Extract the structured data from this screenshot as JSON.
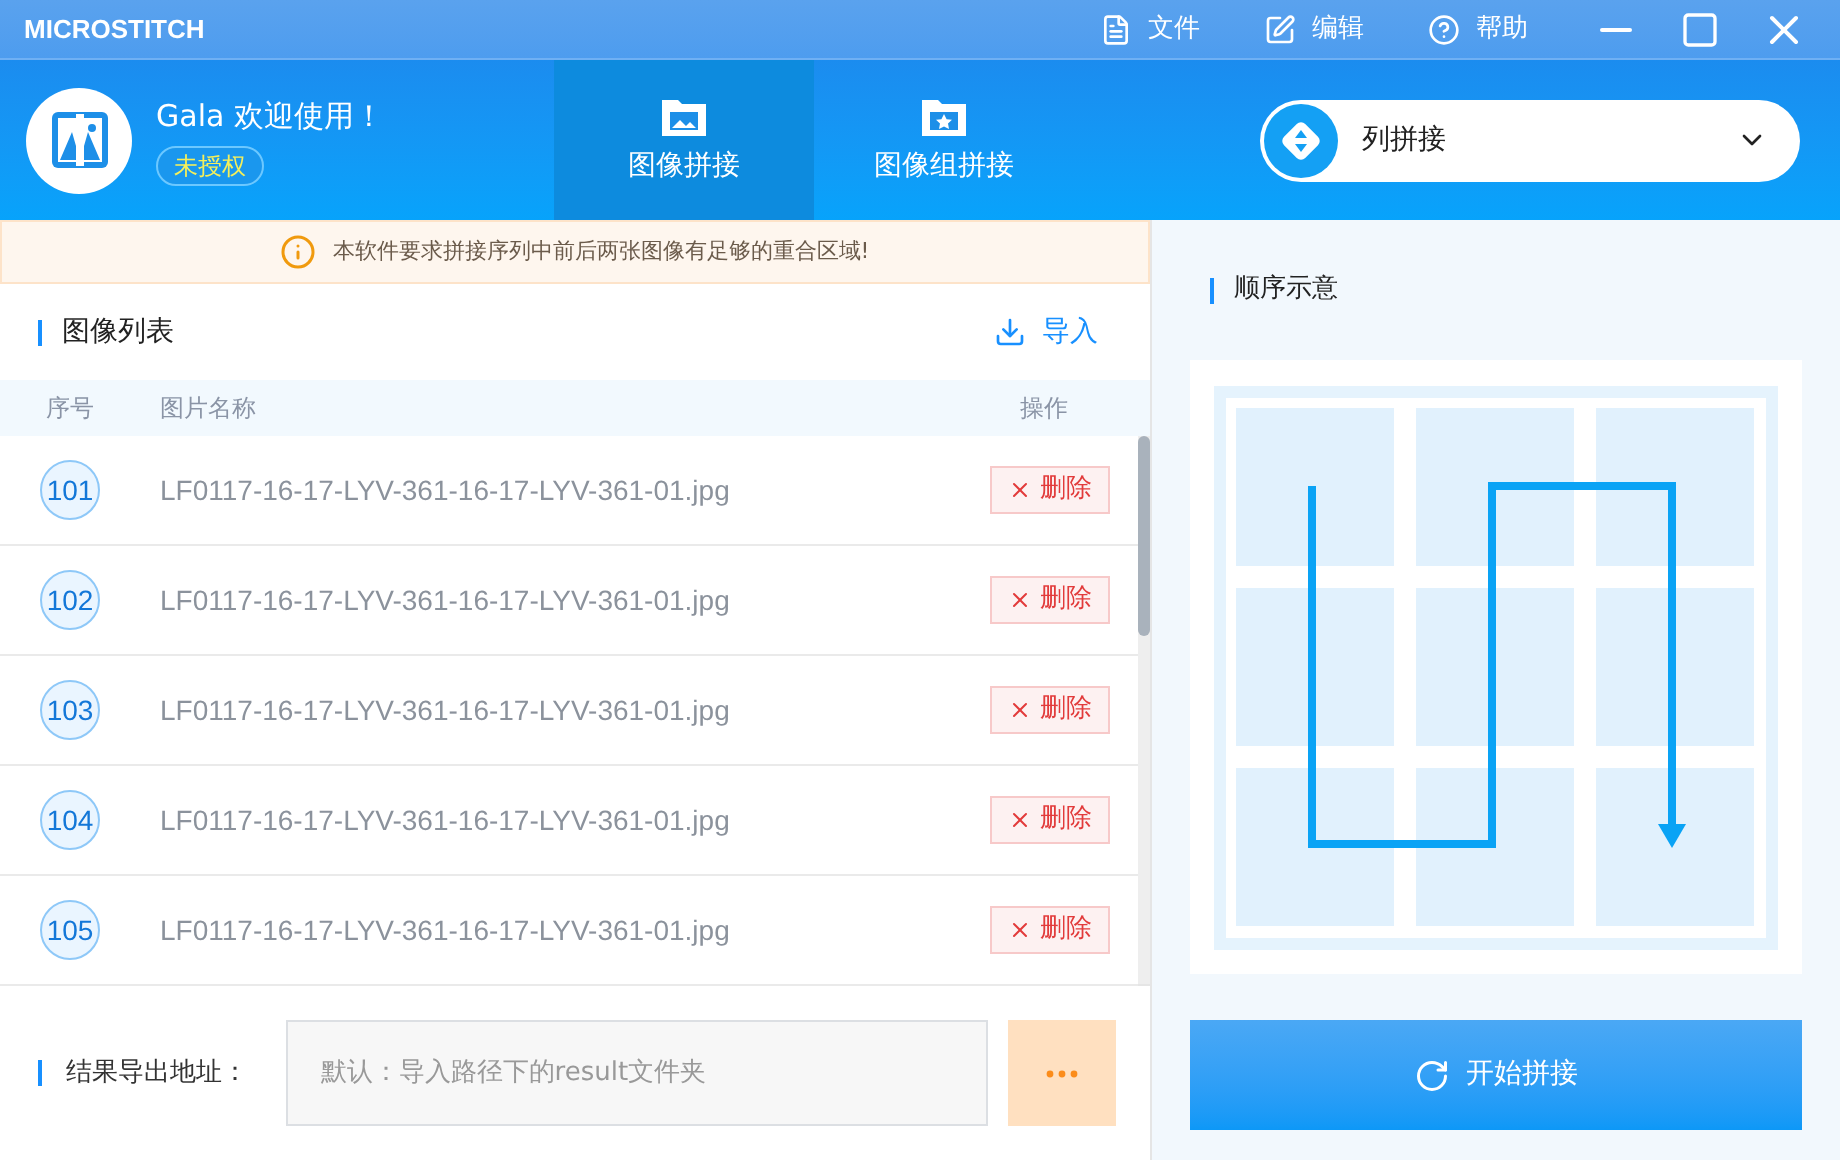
{
  "app": {
    "title": "MICROSTITCH"
  },
  "menu": [
    {
      "kind": "file",
      "label": "文件"
    },
    {
      "kind": "edit",
      "label": "编辑"
    },
    {
      "kind": "help",
      "label": "帮助"
    }
  ],
  "user": {
    "greeting": "Gala 欢迎使用！",
    "license_badge": "未授权"
  },
  "tabs": [
    {
      "kind": "image",
      "label": "图像拼接",
      "selected": true
    },
    {
      "kind": "group",
      "label": "图像组拼接",
      "selected": false
    }
  ],
  "mode_select": {
    "value": "列拼接"
  },
  "notice": "本软件要求拼接序列中前后两张图像有足够的重合区域!",
  "image_list": {
    "title": "图像列表",
    "import_button": "导入",
    "columns": [
      "序号",
      "图片名称",
      "操作"
    ],
    "rows": [
      {
        "index": "101",
        "name": "LF0117-16-17-LYV-361-16-17-LYV-361-01.jpg",
        "action": "删除"
      },
      {
        "index": "102",
        "name": "LF0117-16-17-LYV-361-16-17-LYV-361-01.jpg",
        "action": "删除"
      },
      {
        "index": "103",
        "name": "LF0117-16-17-LYV-361-16-17-LYV-361-01.jpg",
        "action": "删除"
      },
      {
        "index": "104",
        "name": "LF0117-16-17-LYV-361-16-17-LYV-361-01.jpg",
        "action": "删除"
      },
      {
        "index": "105",
        "name": "LF0117-16-17-LYV-361-16-17-LYV-361-01.jpg",
        "action": "删除"
      }
    ]
  },
  "output": {
    "label": "结果导出地址：",
    "placeholder": "默认：导入路径下的result文件夹"
  },
  "order_preview": {
    "title": "顺序示意"
  },
  "start_button": "开始拼接"
}
